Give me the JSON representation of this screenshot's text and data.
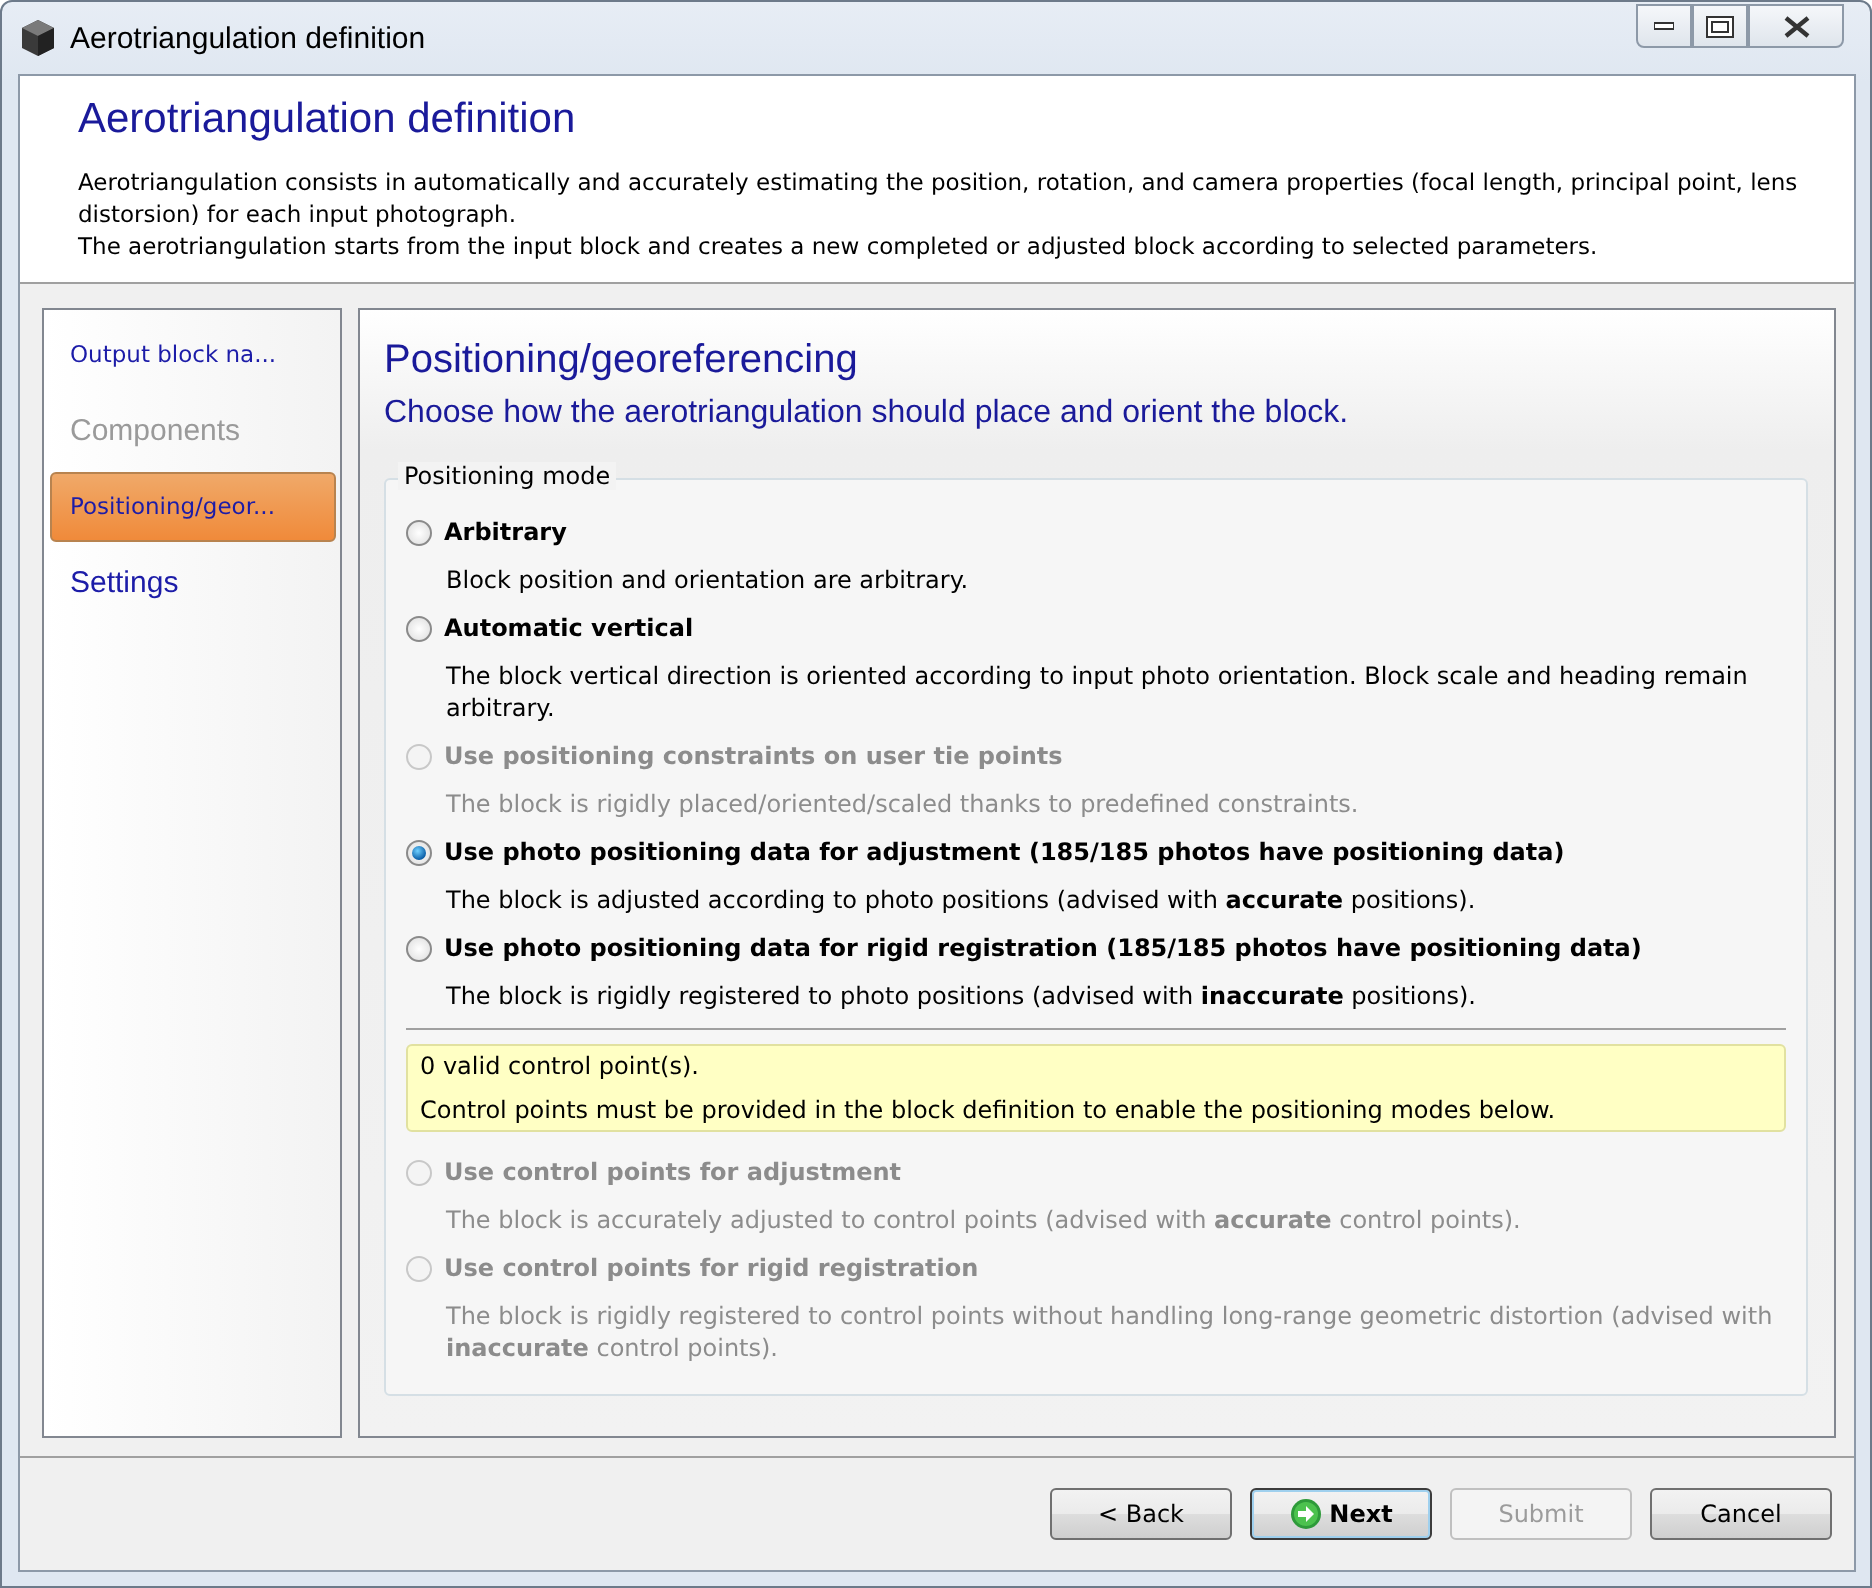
{
  "window": {
    "title": "Aerotriangulation definition"
  },
  "header": {
    "title": "Aerotriangulation definition",
    "description": [
      "Aerotriangulation consists in automatically and accurately estimating the position, rotation, and camera properties (focal length, principal point, lens distorsion) for each input photograph.",
      "The aerotriangulation starts from the input block and creates a new completed or adjusted block according to selected parameters."
    ]
  },
  "sidebar": {
    "items": [
      {
        "label": "Output block na...",
        "selected": false,
        "disabled": false,
        "visited": true
      },
      {
        "label": "Components",
        "selected": false,
        "disabled": true,
        "visited": false
      },
      {
        "label": "Positioning/geor...",
        "selected": true,
        "disabled": false,
        "visited": true
      },
      {
        "label": "Settings",
        "selected": false,
        "disabled": false,
        "visited": false
      }
    ]
  },
  "page": {
    "title": "Positioning/georeferencing",
    "subtitle": "Choose how the aerotriangulation should place and orient the block.",
    "group_title": "Positioning mode",
    "options": [
      {
        "label": "Arbitrary",
        "description": "Block position and orientation are arbitrary.",
        "selected": false,
        "disabled": false
      },
      {
        "label": "Automatic vertical",
        "description": "The block vertical direction is oriented according to input photo orientation. Block scale and heading remain arbitrary.",
        "selected": false,
        "disabled": false
      },
      {
        "label": "Use positioning constraints on user tie points",
        "description": "The block is rigidly placed/oriented/scaled thanks to predefined constraints.",
        "selected": false,
        "disabled": true
      },
      {
        "label": "Use photo positioning data for adjustment (185/185 photos have positioning data)",
        "description": "The block is adjusted according to photo positions (advised with **accurate** positions).",
        "selected": true,
        "disabled": false
      },
      {
        "label": "Use photo positioning data for rigid registration (185/185 photos have positioning data)",
        "description": "The block is rigidly registered to photo positions (advised with **inaccurate** positions).",
        "selected": false,
        "disabled": false
      }
    ],
    "note": [
      "0 valid control point(s).",
      "Control points must be provided in the block definition to enable the positioning modes below."
    ],
    "control_options": [
      {
        "label": "Use control points for adjustment",
        "description": "The block is accurately adjusted to control points (advised with **accurate** control points).",
        "selected": false,
        "disabled": true
      },
      {
        "label": "Use control points for rigid registration",
        "description": "The block is rigidly registered to control points without handling long-range geometric distortion (advised with **inaccurate** control points).",
        "selected": false,
        "disabled": true
      }
    ]
  },
  "buttons": [
    {
      "label": "< Back",
      "disabled": false,
      "default": false
    },
    {
      "label": "Next",
      "disabled": false,
      "default": true
    },
    {
      "label": "Submit",
      "disabled": true,
      "default": false
    },
    {
      "label": "Cancel",
      "disabled": false,
      "default": false
    }
  ]
}
